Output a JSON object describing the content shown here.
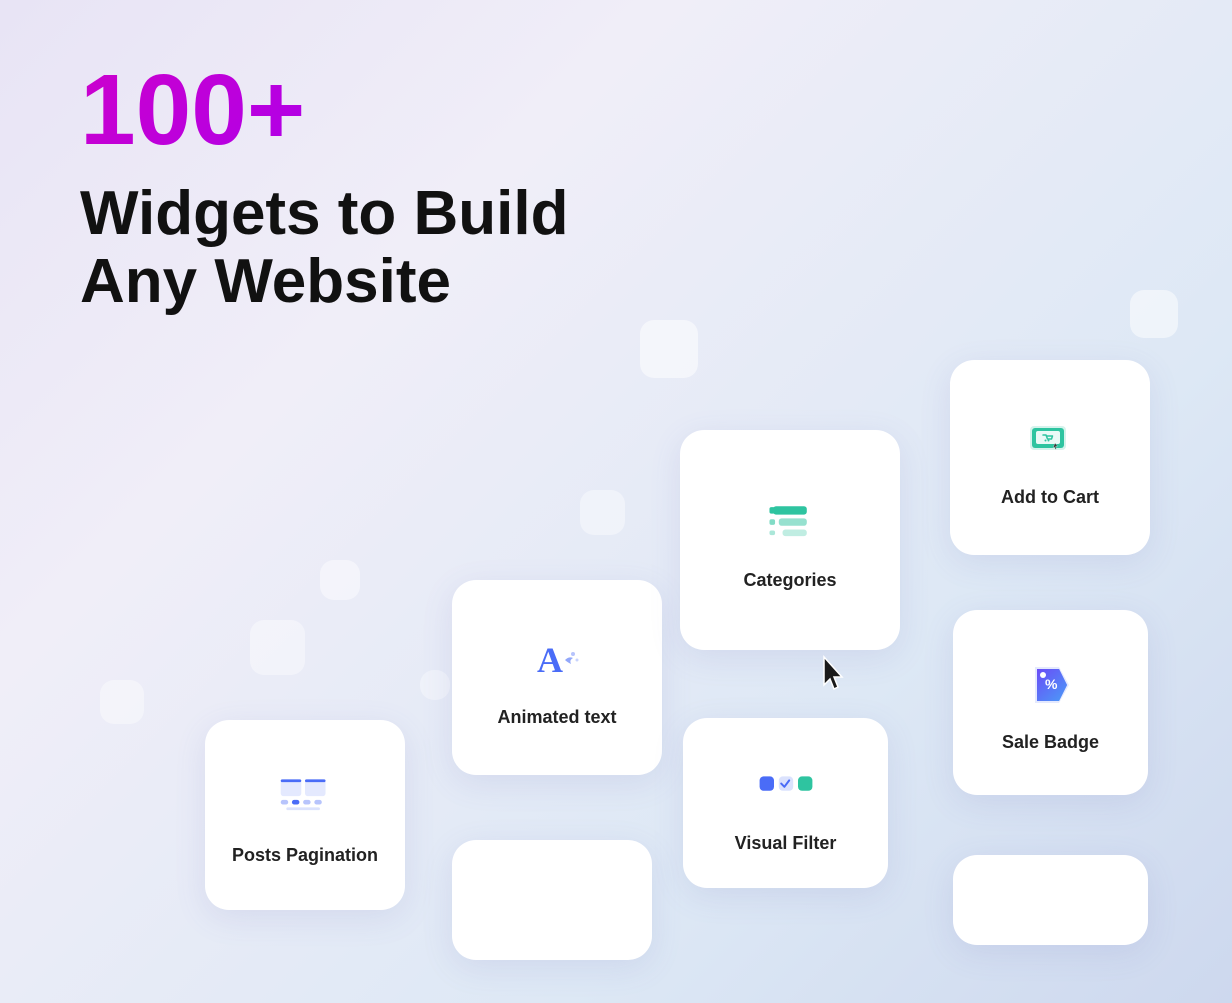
{
  "hero": {
    "number": "100+",
    "subtitle_line1": "Widgets to Build",
    "subtitle_line2": "Any Website"
  },
  "cards": {
    "categories": {
      "label": "Categories"
    },
    "add_to_cart": {
      "label": "Add to Cart"
    },
    "animated_text": {
      "label": "Animated text"
    },
    "posts_pagination": {
      "label": "Posts Pagination"
    },
    "sale_badge": {
      "label": "Sale Badge"
    },
    "visual_filter": {
      "label": "Visual Filter"
    }
  },
  "colors": {
    "purple_gradient_start": "#cc00cc",
    "purple_gradient_end": "#6600ff",
    "teal": "#2ec4a0",
    "blue": "#4a6cf7",
    "dark_blue": "#1a3b8b"
  }
}
